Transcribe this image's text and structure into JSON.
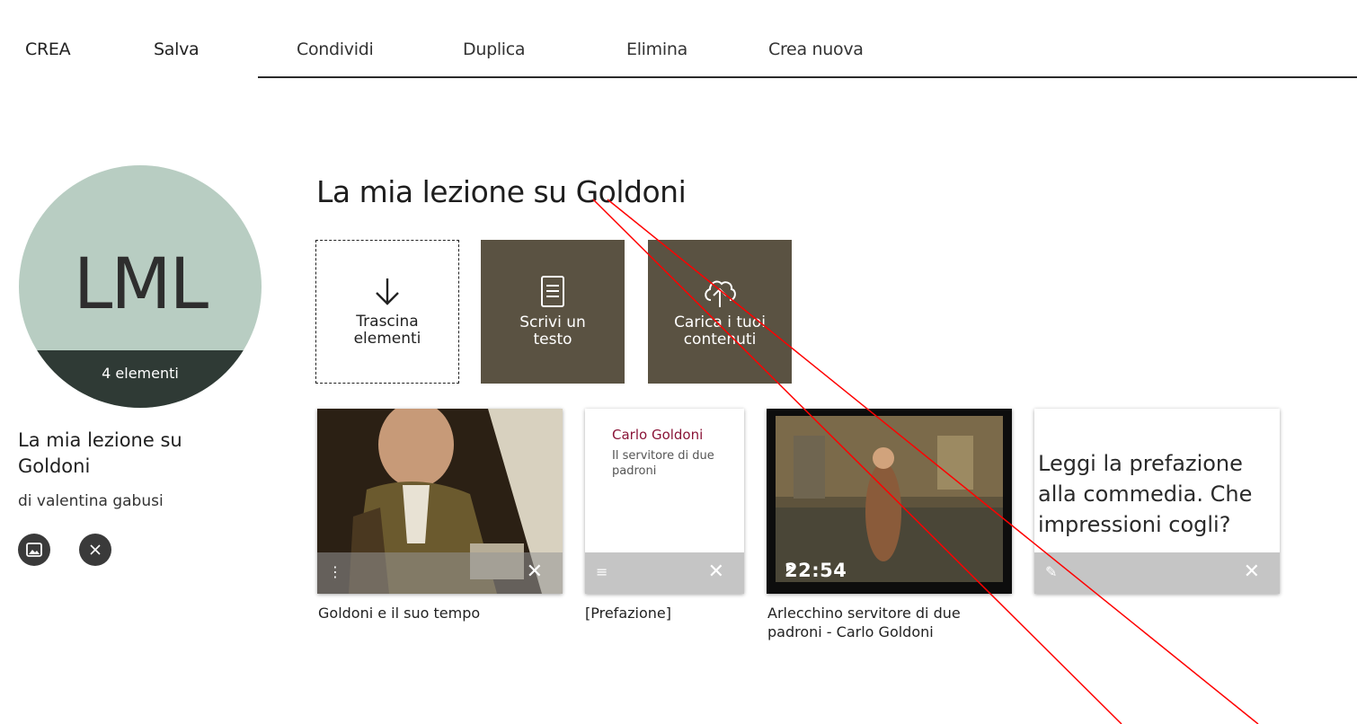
{
  "nav": {
    "items": [
      "CREA",
      "Salva",
      "Condividi",
      "Duplica",
      "Elimina",
      "Crea nuova"
    ]
  },
  "profile": {
    "initials": "LML",
    "count_label": "4 elementi",
    "title": "La mia lezione su Goldoni",
    "author": "di valentina gabusi",
    "avatar_color": "#b8cdc2"
  },
  "main": {
    "title": "La mia lezione su Goldoni"
  },
  "tools": {
    "drag": "Trascina elementi",
    "write": "Scrivi un testo",
    "upload": "Carica i tuoi contenuti",
    "tool_color": "#5a5242"
  },
  "cards": [
    {
      "caption": "Goldoni e il suo tempo",
      "type_icon": "gallery-icon"
    },
    {
      "caption": "[Prefazione]",
      "doc_title": "Carlo Goldoni",
      "doc_sub": "Il servitore di due padroni",
      "type_icon": "document-icon"
    },
    {
      "caption": "Arlecchino servitore di due padroni - Carlo Goldoni",
      "duration": "22:54",
      "type_icon": "youtube-icon"
    },
    {
      "caption": "",
      "text": "Leggi la prefazione alla commedia. Che impressioni cogli?",
      "type_icon": "pencil-icon"
    }
  ],
  "annotation_color": "#ff0000"
}
